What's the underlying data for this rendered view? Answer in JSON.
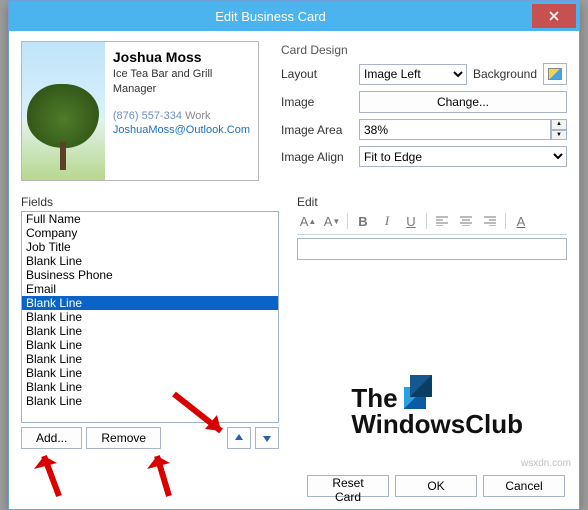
{
  "titlebar": {
    "title": "Edit Business Card"
  },
  "preview": {
    "name": "Joshua Moss",
    "company": "Ice Tea Bar and Grill",
    "job": "Manager",
    "phone": "(876) 557-334",
    "phone_label": "Work",
    "email": "JoshuaMoss@Outlook.Com"
  },
  "card_design": {
    "heading": "Card Design",
    "layout_label": "Layout",
    "layout_value": "Image Left",
    "background_label": "Background",
    "image_label": "Image",
    "change_btn": "Change...",
    "area_label": "Image Area",
    "area_value": "38%",
    "align_label": "Image Align",
    "align_value": "Fit to Edge"
  },
  "fields": {
    "heading": "Fields",
    "items": [
      {
        "label": "Full Name"
      },
      {
        "label": "Company"
      },
      {
        "label": "Job Title"
      },
      {
        "label": "Blank Line"
      },
      {
        "label": "Business Phone"
      },
      {
        "label": "Email"
      },
      {
        "label": "Blank Line",
        "selected": true
      },
      {
        "label": "Blank Line"
      },
      {
        "label": "Blank Line"
      },
      {
        "label": "Blank Line"
      },
      {
        "label": "Blank Line"
      },
      {
        "label": "Blank Line"
      },
      {
        "label": "Blank Line"
      },
      {
        "label": "Blank Line"
      }
    ],
    "add_btn": "Add...",
    "remove_btn": "Remove"
  },
  "edit": {
    "heading": "Edit",
    "value": ""
  },
  "logo": {
    "line1": "The",
    "line2": "WindowsClub"
  },
  "buttons": {
    "reset": "Reset Card",
    "ok": "OK",
    "cancel": "Cancel"
  },
  "watermark": "wsxdn.com"
}
